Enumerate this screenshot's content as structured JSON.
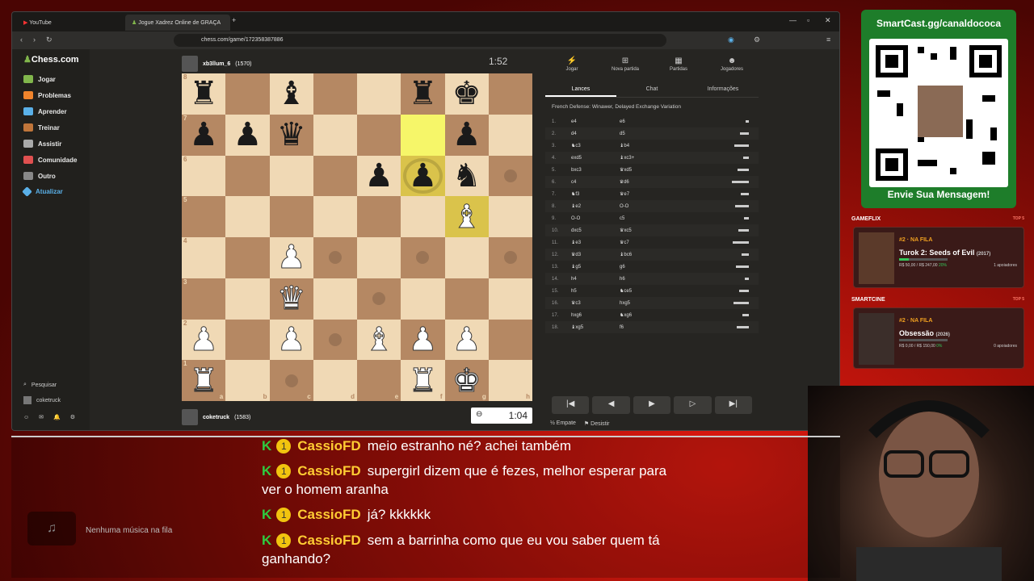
{
  "browser": {
    "tabs": [
      {
        "label": "YouTube"
      },
      {
        "label": "Jogue Xadrez Online de GRAÇA"
      }
    ],
    "url": "chess.com/game/172358387886"
  },
  "chess_sidebar": {
    "logo": "Chess.com",
    "items": [
      {
        "label": "Jogar",
        "color": "#81b64c"
      },
      {
        "label": "Problemas",
        "color": "#f0842c"
      },
      {
        "label": "Aprender",
        "color": "#5ab0e8"
      },
      {
        "label": "Treinar",
        "color": "#c0753a"
      },
      {
        "label": "Assistir",
        "color": "#aaaaaa"
      },
      {
        "label": "Comunidade",
        "color": "#e05050"
      },
      {
        "label": "Outro",
        "color": "#888888"
      },
      {
        "label": "Atualizar",
        "color": "#5ab0e8"
      }
    ],
    "search": "Pesquisar",
    "user": "coketruck"
  },
  "game": {
    "top_player": {
      "name": "xb3llum_6",
      "rating": "(1570)",
      "clock": "1:52"
    },
    "bottom_player": {
      "name": "coketruck",
      "rating": "(1583)",
      "clock": "1:04"
    },
    "files": [
      "a",
      "b",
      "c",
      "d",
      "e",
      "f",
      "g",
      "h"
    ],
    "ranks": [
      "8",
      "7",
      "6",
      "5",
      "4",
      "3",
      "2",
      "1"
    ],
    "board": [
      [
        "r",
        "",
        "b",
        "",
        "",
        "r",
        "k",
        ""
      ],
      [
        "p",
        "p",
        "q",
        "",
        "",
        "",
        "p",
        ""
      ],
      [
        "",
        "",
        "",
        "",
        "p",
        "p",
        "n",
        ""
      ],
      [
        "",
        "",
        "",
        "",
        "",
        "",
        "B",
        ""
      ],
      [
        "",
        "",
        "P",
        "",
        "",
        "",
        "",
        ""
      ],
      [
        "",
        "",
        "Q",
        "",
        "",
        "",
        "",
        ""
      ],
      [
        "P",
        "",
        "P",
        "",
        "B",
        "P",
        "P",
        ""
      ],
      [
        "R",
        "",
        "",
        "",
        "",
        "R",
        "K",
        ""
      ]
    ],
    "highlights": [
      "f7",
      "f6",
      "g5"
    ]
  },
  "panel": {
    "tabs": [
      {
        "label": "Jogar",
        "icon": "bolt-icon"
      },
      {
        "label": "Nova partida",
        "icon": "plus-icon"
      },
      {
        "label": "Partidas",
        "icon": "grid-icon"
      },
      {
        "label": "Jogadores",
        "icon": "players-icon"
      }
    ],
    "subtabs": [
      "Lances",
      "Chat",
      "Informações"
    ],
    "opening": "French Defense: Winawer, Delayed Exchange Variation",
    "moves": [
      {
        "n": "1.",
        "w": "e4",
        "b": "e6"
      },
      {
        "n": "2.",
        "w": "d4",
        "b": "d5"
      },
      {
        "n": "3.",
        "w": "♞c3",
        "b": "♝b4"
      },
      {
        "n": "4.",
        "w": "exd5",
        "b": "♝xc3+"
      },
      {
        "n": "5.",
        "w": "bxc3",
        "b": "♛xd5"
      },
      {
        "n": "6.",
        "w": "c4",
        "b": "♛d6"
      },
      {
        "n": "7.",
        "w": "♞f3",
        "b": "♛e7"
      },
      {
        "n": "8.",
        "w": "♝e2",
        "b": "O-O"
      },
      {
        "n": "9.",
        "w": "O-O",
        "b": "c5"
      },
      {
        "n": "10.",
        "w": "dxc5",
        "b": "♛xc5"
      },
      {
        "n": "11.",
        "w": "♝e3",
        "b": "♛c7"
      },
      {
        "n": "12.",
        "w": "♛d3",
        "b": "♝bc6"
      },
      {
        "n": "13.",
        "w": "♝g5",
        "b": "g6"
      },
      {
        "n": "14.",
        "w": "h4",
        "b": "h6"
      },
      {
        "n": "15.",
        "w": "h5",
        "b": "♞ce5"
      },
      {
        "n": "16.",
        "w": "♛c3",
        "b": "hxg5"
      },
      {
        "n": "17.",
        "w": "hxg6",
        "b": "♞xg6"
      },
      {
        "n": "18.",
        "w": "♝xg5",
        "b": "f6"
      }
    ],
    "draw": "Empate",
    "resign": "Desistir"
  },
  "smartcast": {
    "title": "SmartCast.gg/canaldococa",
    "footer": "Envie Sua Mensagem!"
  },
  "gameflix": {
    "header": "GAMEFLIX",
    "top": "TOP 5",
    "rank": "#2",
    "tag": "NA FILA",
    "title": "Turok 2: Seeds of Evil",
    "year": "(2017)",
    "money": "R$ 50,00 / R$ 247,00",
    "pct": "20%",
    "pct_value": 0.2,
    "supporters": "1 apoiadores"
  },
  "smartcine": {
    "header": "SMARTCINE",
    "top": "TOP 5",
    "rank": "#2",
    "tag": "NA FILA",
    "title": "Obsessão",
    "year": "(2026)",
    "money": "R$ 0,00 / R$ 150,00",
    "pct": "0%",
    "pct_value": 0.0,
    "supporters": "0 apoiadores"
  },
  "music": {
    "empty": "Nenhuma música na fila"
  },
  "chat": [
    {
      "user": "CassioFD",
      "text": "meio estranho né? achei também"
    },
    {
      "user": "CassioFD",
      "text": "supergirl dizem que é fezes, melhor esperar para ver o homem aranha"
    },
    {
      "user": "CassioFD",
      "text": "já? kkkkkk"
    },
    {
      "user": "CassioFD",
      "text": "sem a barrinha como que eu vou saber quem tá ganhando?"
    }
  ]
}
